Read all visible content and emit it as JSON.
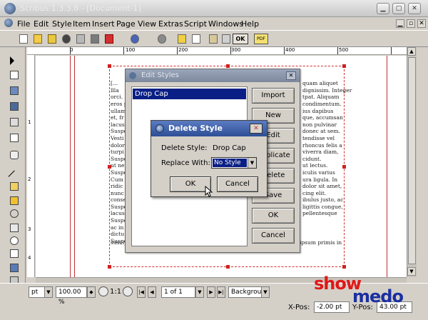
{
  "window": {
    "title": "Scribus 1.3.3.8 - [Document-1]"
  },
  "menu": [
    "File",
    "Edit",
    "Style",
    "Item",
    "Insert",
    "Page",
    "View",
    "Extras",
    "Script",
    "Windows",
    "Help"
  ],
  "toolbar": {
    "ok_label": "OK",
    "pdf_label": "PDF"
  },
  "ruler": {
    "labels": [
      "0",
      "100",
      "200",
      "300",
      "400",
      "500"
    ],
    "vlabels": [
      "1",
      "2",
      "3",
      "4"
    ]
  },
  "document": {
    "left_column": [
      "[...",
      "llla",
      "orci.",
      "eros p",
      "ullam",
      "et, fr",
      "lacus",
      "Suspe",
      "Vesti",
      "dolor",
      "turpi",
      "Suspe",
      "ut ne",
      "Suspe",
      "Cum",
      "ridic",
      "nunc",
      "conse",
      "Suspe",
      "lacus",
      "Suspe",
      "ac in",
      "dictu",
      "Suspe",
      "suscipit erat vitae mauris. Sed iaculis eros vitae est. Vestibulum ante ipsum primis in"
    ],
    "right_column": [
      "quam aliquet",
      "dignissim. Integer",
      "tpat. Aliquam",
      "condimentum.",
      "ius dapibus",
      "que, accumsan",
      "non pulvinar",
      "donec at sem.",
      "tendisse vel",
      "rhoncus felis a",
      "viverra diam,",
      "cidunt.",
      "ut lectus.",
      "iculis varius",
      "ura ligula. In",
      "",
      "dolor sit amet,",
      "cing elit.",
      "ibulus justo, ac",
      "ligittis congue,",
      "pellentesque"
    ]
  },
  "edit_styles": {
    "title": "Edit Styles",
    "selected_style": "Drop  Cap",
    "buttons": [
      "Import",
      "New",
      "Edit",
      "Duplicate",
      "Delete",
      "Save",
      "OK",
      "Cancel"
    ]
  },
  "delete_style": {
    "title": "Delete Style",
    "delete_label": "Delete Style:",
    "delete_value": "Drop  Cap",
    "replace_label": "Replace With:",
    "replace_value": "No Style",
    "ok_label": "OK",
    "cancel_label": "Cancel"
  },
  "status": {
    "unit": "pt",
    "zoom": "100.00 %",
    "ratio": "1:1",
    "page": "1 of 1",
    "layer": "Background",
    "xpos_label": "X-Pos:",
    "xpos_value": "-2.00 pt",
    "ypos_label": "Y-Pos:",
    "ypos_value": "43.00 pt"
  },
  "logo": {
    "line1": "show",
    "line2": "medo"
  },
  "colors": {
    "accent": "#0a1f85",
    "frame": "#d03030",
    "logo_red": "#e01818",
    "logo_blue": "#1a2fa0"
  }
}
